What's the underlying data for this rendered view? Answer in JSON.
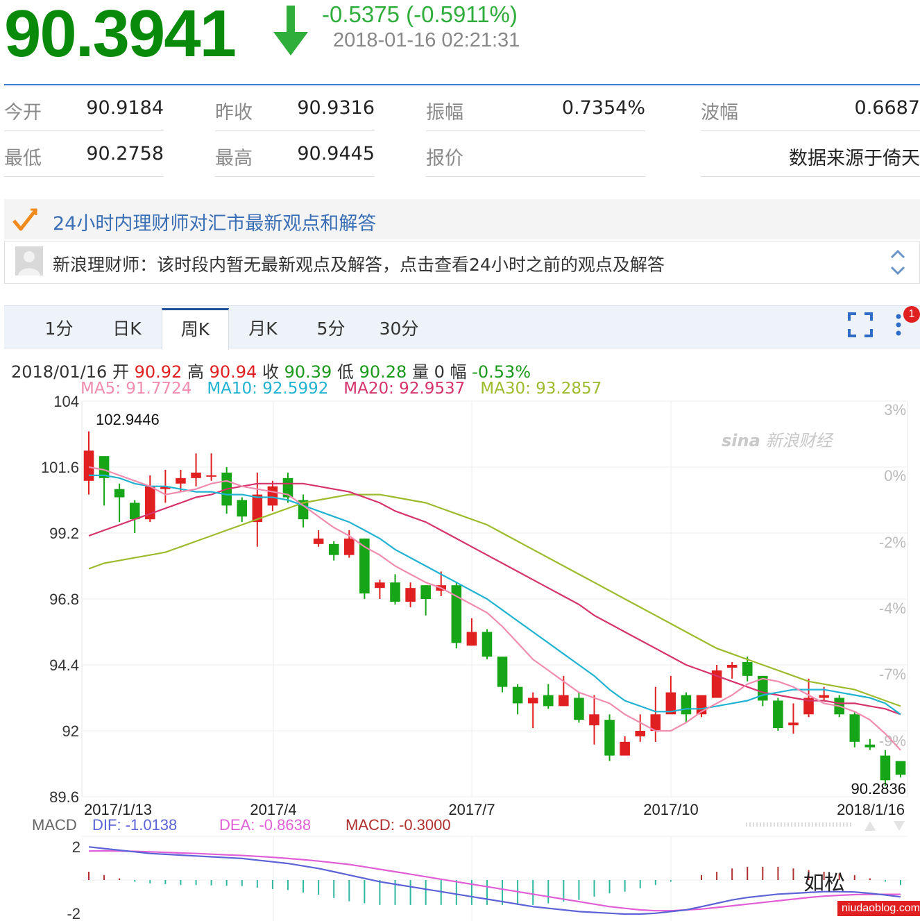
{
  "quote": {
    "price": "90.3941",
    "change": "-0.5375 (-0.5911%)",
    "time": "2018-01-16 02:21:31",
    "colors": {
      "down": "#0a8a0a",
      "change": "#2fae3c"
    }
  },
  "stats": [
    {
      "label": "今开",
      "value": "90.9184"
    },
    {
      "label": "昨收",
      "value": "90.9316"
    },
    {
      "label": "振幅",
      "value": "0.7354%"
    },
    {
      "label": "波幅",
      "value": "0.6687"
    },
    {
      "label": "最低",
      "value": "90.2758"
    },
    {
      "label": "最高",
      "value": "90.9445"
    },
    {
      "label": "报价",
      "value": ""
    },
    {
      "label": "",
      "value": "数据来源于倚天"
    }
  ],
  "advisor": {
    "title": "24小时内理财师对汇市最新观点和解答",
    "message": "新浪理财师：该时段内暂无最新观点及解答，点击查看24小时之前的观点及解答"
  },
  "tabs": [
    "1分",
    "日K",
    "周K",
    "月K",
    "5分",
    "30分"
  ],
  "active_tab": "周K",
  "badge": "1",
  "info": {
    "date": "2018/01/16",
    "open_label": "开",
    "open": "90.92",
    "high_label": "高",
    "high": "90.94",
    "close_label": "收",
    "close": "90.39",
    "low_label": "低",
    "low": "90.28",
    "vol_label": "量",
    "vol": "0",
    "amp_label": "幅",
    "amp": "-0.53%"
  },
  "ma": {
    "ma5": "MA5: 91.7724",
    "ma10": "MA10: 92.5992",
    "ma20": "MA20: 92.9537",
    "ma30": "MA30: 93.2857"
  },
  "watermark": "新浪财经",
  "watermark2": "如松",
  "watermark3": "niudaoblog.com",
  "chart_data": {
    "type": "candlestick",
    "y_ticks": [
      "104",
      "101.6",
      "99.2",
      "96.8",
      "94.4",
      "92",
      "89.6"
    ],
    "pct_ticks": [
      "3%",
      "0%",
      "-2%",
      "-4%",
      "-7%",
      "-9%"
    ],
    "x_ticks": [
      "2017/1/13",
      "2017/4",
      "2017/7",
      "2017/10",
      "2018/1/16"
    ],
    "ylim": [
      89.6,
      104
    ],
    "max_label": "102.9446",
    "min_label": "90.2836",
    "colors": {
      "up": "#e02020",
      "down": "#16a516",
      "ma5": "#f08cb0",
      "ma10": "#21b3d2",
      "ma20": "#d6336c",
      "ma30": "#9dbb2c"
    },
    "candles": [
      [
        101.1,
        102.2,
        102.9,
        100.6
      ],
      [
        102.0,
        101.2,
        101.3,
        100.2
      ],
      [
        100.8,
        100.5,
        101.0,
        99.6
      ],
      [
        100.3,
        99.7,
        100.4,
        99.2
      ],
      [
        99.7,
        100.9,
        101.3,
        99.6
      ],
      [
        100.8,
        100.9,
        101.5,
        100.3
      ],
      [
        101.0,
        101.2,
        101.5,
        100.7
      ],
      [
        101.2,
        101.4,
        102.1,
        100.9
      ],
      [
        101.3,
        101.3,
        102.1,
        101.1
      ],
      [
        101.4,
        100.2,
        101.6,
        99.9
      ],
      [
        100.4,
        99.8,
        100.5,
        99.6
      ],
      [
        99.6,
        100.6,
        101.4,
        98.7
      ],
      [
        100.2,
        100.9,
        101.1,
        100.0
      ],
      [
        101.2,
        100.5,
        101.4,
        100.3
      ],
      [
        100.4,
        99.7,
        100.6,
        99.4
      ],
      [
        98.8,
        99.0,
        99.3,
        98.7
      ],
      [
        98.8,
        98.4,
        98.9,
        98.2
      ],
      [
        98.4,
        99.0,
        99.3,
        98.3
      ],
      [
        99.0,
        97.0,
        99.0,
        96.8
      ],
      [
        97.2,
        97.4,
        97.5,
        96.8
      ],
      [
        97.4,
        96.7,
        97.7,
        96.6
      ],
      [
        96.7,
        97.2,
        97.4,
        96.5
      ],
      [
        97.3,
        96.8,
        97.3,
        96.2
      ],
      [
        97.1,
        97.3,
        97.8,
        96.9
      ],
      [
        97.3,
        95.2,
        97.4,
        95.0
      ],
      [
        95.1,
        95.6,
        96.1,
        95.1
      ],
      [
        95.6,
        94.7,
        95.7,
        94.6
      ],
      [
        94.7,
        93.6,
        94.7,
        93.4
      ],
      [
        93.6,
        93.0,
        93.7,
        92.6
      ],
      [
        93.0,
        93.2,
        93.4,
        92.1
      ],
      [
        93.3,
        92.9,
        93.7,
        92.8
      ],
      [
        92.9,
        93.3,
        94.0,
        92.9
      ],
      [
        93.2,
        92.4,
        93.4,
        92.3
      ],
      [
        92.2,
        92.6,
        93.3,
        91.5
      ],
      [
        92.4,
        91.1,
        92.6,
        90.9
      ],
      [
        91.1,
        91.6,
        91.8,
        91.2
      ],
      [
        91.8,
        92.0,
        92.6,
        91.6
      ],
      [
        92.0,
        92.6,
        93.6,
        91.6
      ],
      [
        92.6,
        93.4,
        94.0,
        92.7
      ],
      [
        93.3,
        92.6,
        93.4,
        92.3
      ],
      [
        92.6,
        93.3,
        93.3,
        92.5
      ],
      [
        93.2,
        94.2,
        94.4,
        93.2
      ],
      [
        94.3,
        94.4,
        94.5,
        93.9
      ],
      [
        94.5,
        94.0,
        94.7,
        93.8
      ],
      [
        94.0,
        93.1,
        94.0,
        92.9
      ],
      [
        93.1,
        92.1,
        93.2,
        92.0
      ],
      [
        92.2,
        92.3,
        93.0,
        91.9
      ],
      [
        92.6,
        93.2,
        93.9,
        92.5
      ],
      [
        93.2,
        93.3,
        93.6,
        93.1
      ],
      [
        93.2,
        92.6,
        93.3,
        92.5
      ],
      [
        92.6,
        91.6,
        92.7,
        91.4
      ],
      [
        91.5,
        91.4,
        91.7,
        91.3
      ],
      [
        91.1,
        90.2,
        91.3,
        90.0
      ],
      [
        90.9,
        90.4,
        90.9,
        90.3
      ]
    ],
    "ma5": [
      101.6,
      101.5,
      101.3,
      101.1,
      100.9,
      100.6,
      100.7,
      100.8,
      101.0,
      101.1,
      100.9,
      100.8,
      100.7,
      100.6,
      100.2,
      99.8,
      99.4,
      99.1,
      98.7,
      98.4,
      98.0,
      97.7,
      97.4,
      97.2,
      96.9,
      96.6,
      96.3,
      95.8,
      95.2,
      94.6,
      94.2,
      93.8,
      93.4,
      93.2,
      93.0,
      92.6,
      92.3,
      92.0,
      92.0,
      92.3,
      92.7,
      93.0,
      93.3,
      93.7,
      93.9,
      93.8,
      93.6,
      93.3,
      93.0,
      92.9,
      92.7,
      92.4,
      91.9,
      91.3
    ],
    "ma10": [
      101.3,
      101.3,
      101.2,
      101.0,
      100.9,
      100.9,
      100.8,
      100.7,
      100.7,
      100.6,
      100.6,
      100.5,
      100.5,
      100.4,
      100.2,
      100.0,
      99.8,
      99.6,
      99.3,
      99.0,
      98.6,
      98.3,
      98.0,
      97.7,
      97.4,
      97.1,
      96.8,
      96.4,
      96.0,
      95.6,
      95.2,
      94.8,
      94.4,
      94.0,
      93.5,
      93.1,
      92.9,
      92.7,
      92.7,
      92.8,
      92.8,
      92.9,
      93.0,
      93.1,
      93.3,
      93.4,
      93.5,
      93.5,
      93.5,
      93.4,
      93.3,
      93.2,
      93.0,
      92.6
    ],
    "ma20": [
      99.1,
      99.3,
      99.5,
      99.7,
      99.9,
      100.1,
      100.3,
      100.5,
      100.6,
      100.8,
      100.9,
      101.0,
      101.0,
      101.0,
      101.0,
      100.9,
      100.8,
      100.7,
      100.5,
      100.3,
      100.0,
      99.8,
      99.6,
      99.3,
      99.0,
      98.7,
      98.4,
      98.1,
      97.8,
      97.5,
      97.2,
      96.9,
      96.6,
      96.2,
      95.9,
      95.6,
      95.3,
      95.0,
      94.7,
      94.4,
      94.2,
      94.0,
      93.8,
      93.6,
      93.4,
      93.3,
      93.2,
      93.1,
      93.1,
      93.0,
      93.0,
      92.9,
      92.8,
      92.6
    ],
    "ma30": [
      97.9,
      98.1,
      98.2,
      98.3,
      98.4,
      98.5,
      98.7,
      98.9,
      99.1,
      99.3,
      99.5,
      99.7,
      99.9,
      100.1,
      100.3,
      100.4,
      100.5,
      100.6,
      100.6,
      100.6,
      100.5,
      100.4,
      100.3,
      100.1,
      99.9,
      99.7,
      99.5,
      99.2,
      98.9,
      98.6,
      98.3,
      98.0,
      97.7,
      97.4,
      97.1,
      96.8,
      96.5,
      96.2,
      95.9,
      95.6,
      95.3,
      95.0,
      94.8,
      94.6,
      94.4,
      94.2,
      94.0,
      93.8,
      93.7,
      93.6,
      93.5,
      93.3,
      93.1,
      92.9
    ],
    "macd_labels": {
      "name": "MACD",
      "dif": "DIF: -1.0138",
      "dea": "DEA: -0.8638",
      "macd": "MACD: -0.3000"
    },
    "macd_ticks": [
      "2",
      "-2"
    ],
    "macd_ylim": [
      -2.3,
      2.3
    ],
    "dif": [
      2.0,
      1.9,
      1.8,
      1.7,
      1.6,
      1.55,
      1.5,
      1.45,
      1.4,
      1.35,
      1.3,
      1.2,
      1.1,
      1.0,
      0.85,
      0.7,
      0.5,
      0.3,
      0.1,
      -0.1,
      -0.25,
      -0.4,
      -0.55,
      -0.7,
      -0.85,
      -1.0,
      -1.15,
      -1.3,
      -1.45,
      -1.6,
      -1.7,
      -1.8,
      -1.9,
      -1.95,
      -2.0,
      -2.05,
      -2.05,
      -2.0,
      -1.9,
      -1.8,
      -1.6,
      -1.4,
      -1.2,
      -1.05,
      -0.95,
      -0.85,
      -0.8,
      -0.75,
      -0.7,
      -0.7,
      -0.72,
      -0.8,
      -0.9,
      -1.01
    ],
    "dea": [
      1.75,
      1.76,
      1.75,
      1.73,
      1.7,
      1.67,
      1.63,
      1.6,
      1.56,
      1.52,
      1.48,
      1.43,
      1.37,
      1.3,
      1.23,
      1.14,
      1.04,
      0.94,
      0.8,
      0.65,
      0.5,
      0.35,
      0.2,
      0.05,
      -0.1,
      -0.25,
      -0.4,
      -0.55,
      -0.7,
      -0.85,
      -1.0,
      -1.15,
      -1.3,
      -1.45,
      -1.6,
      -1.7,
      -1.8,
      -1.85,
      -1.85,
      -1.8,
      -1.75,
      -1.65,
      -1.55,
      -1.45,
      -1.35,
      -1.25,
      -1.15,
      -1.05,
      -0.97,
      -0.92,
      -0.88,
      -0.86,
      -0.86,
      -0.86
    ],
    "macd_hist": [
      0.5,
      0.3,
      0.1,
      -0.1,
      -0.2,
      -0.25,
      -0.3,
      -0.3,
      -0.32,
      -0.34,
      -0.36,
      -0.46,
      -0.54,
      -0.6,
      -0.76,
      -0.88,
      -1.08,
      -1.28,
      -1.4,
      -1.5,
      -1.5,
      -1.5,
      -1.5,
      -1.5,
      -1.5,
      -1.5,
      -1.5,
      -1.5,
      -1.5,
      -1.5,
      -1.4,
      -1.3,
      -1.2,
      -1.0,
      -0.8,
      -0.7,
      -0.5,
      -0.3,
      -0.1,
      0.0,
      0.3,
      0.5,
      0.7,
      0.8,
      0.8,
      0.8,
      0.7,
      0.6,
      0.5,
      0.4,
      0.3,
      0.1,
      -0.1,
      -0.3
    ]
  }
}
